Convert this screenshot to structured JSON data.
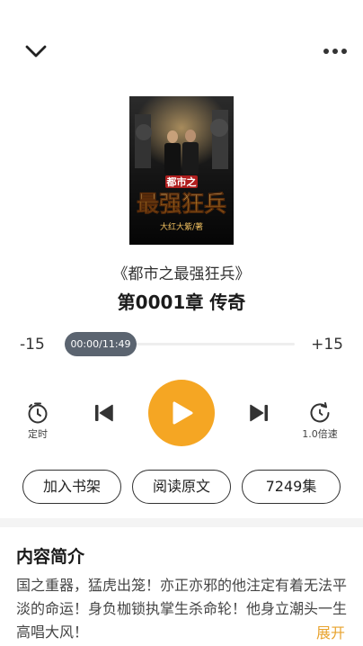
{
  "header": {
    "collapse_icon": "chevron-down-icon",
    "more_icon": "more-dots-icon"
  },
  "cover": {
    "title_small": "都市之",
    "title_large": "最强狂兵",
    "author": "大红大紫/著"
  },
  "book": {
    "title": "《都市之最强狂兵》",
    "chapter": "第0001章 传奇"
  },
  "player": {
    "rewind_label": "-15",
    "forward_label": "+15",
    "time_readout": "00:00/11:49",
    "progress": 0
  },
  "controls": {
    "timer_label": "定时",
    "speed_label": "1.0倍速",
    "play_color": "#f5a623"
  },
  "actions": {
    "add_shelf": "加入书架",
    "read_original": "阅读原文",
    "episodes": "7249集"
  },
  "summary": {
    "heading": "内容简介",
    "text": "国之重器，猛虎出笼！亦正亦邪的他注定有着无法平淡的命运！身负枷锁执掌生杀命轮！他身立潮头一生高唱大风！",
    "expand": "展开",
    "expand_color": "#e8a32e"
  }
}
